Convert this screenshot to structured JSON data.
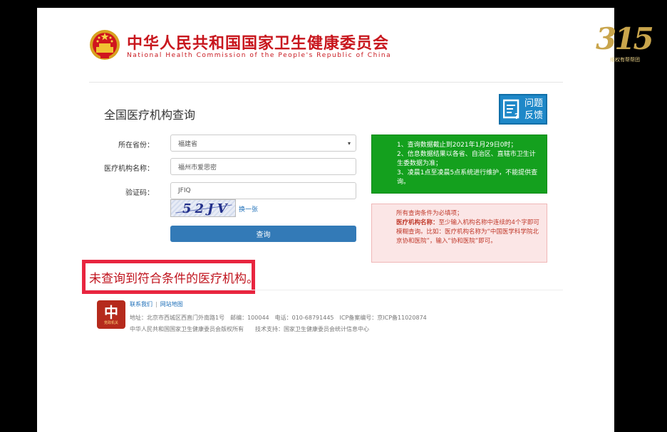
{
  "header": {
    "title_cn": "中华人民共和国国家卫生健康委员会",
    "title_en": "National Health Commission of the People's Republic of China"
  },
  "page": {
    "section_title": "全国医疗机构查询",
    "feedback_line1": "问题",
    "feedback_line2": "反馈"
  },
  "form": {
    "province_label": "所在省份：",
    "province_value": "福建省",
    "name_label": "医疗机构名称：",
    "name_value": "福州市爱思密",
    "captcha_label": "验证码：",
    "captcha_value": "JFIQ",
    "captcha_image_text": "52JV",
    "refresh_label": "换一张",
    "submit_label": "查询"
  },
  "notice_green": {
    "line1": "1、查询数据截止到2021年1月29日0时；",
    "line2": "2、信息数据结果以各省、自治区、直辖市卫生计生委数据为准；",
    "line3": "3、凌晨1点至凌晨5点系统进行维护，不能提供查询。"
  },
  "notice_red": {
    "line1": "所有查询条件为必填项；",
    "line2_bold": "医疗机构名称：",
    "line2_rest": "至少输入机构名称中连续的4个字即可模糊查询。比如：医疗机构名称为“中国医学科学院北京协和医院”，输入“协和医院”即可。"
  },
  "result": {
    "message": "未查询到符合条件的医疗机构。"
  },
  "footer": {
    "logo_caption": "党政机关",
    "link_contact": "联系我们",
    "link_separator": "|",
    "link_sitemap": "网站地图",
    "address": "地址：北京市西城区西直门外南路1号　邮编：100044　电话：010-68791445　ICP备案编号：京ICP备11020874",
    "copyright": "中华人民共和国国家卫生健康委员会版权所有　　技术支持：国家卫生健康委员会统计信息中心"
  },
  "watermark": {
    "number": "315",
    "caption": "维权有帮帮团"
  },
  "colors": {
    "brand_red": "#c8161d",
    "notice_green": "#14a01e",
    "button_blue": "#337ab7",
    "highlight_border": "#e8253f"
  }
}
